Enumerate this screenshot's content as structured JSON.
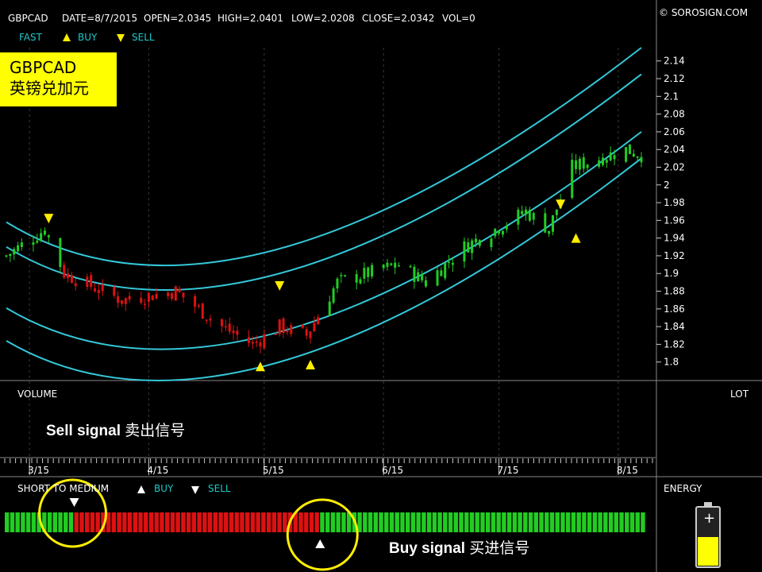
{
  "header": {
    "symbol": "GBPCAD",
    "date": "DATE=8/7/2015",
    "open": "OPEN=2.0345",
    "high": "HIGH=2.0401",
    "low": "LOW=2.0208",
    "close": "CLOSE=2.0342",
    "vol": "VOL=0",
    "copyright": "© SOROSIGN.COM"
  },
  "legend": {
    "fast": "FAST",
    "buy": "BUY",
    "sell": "SELL"
  },
  "instrument_box": {
    "line1": "GBPCAD",
    "line2": "英镑兑加元"
  },
  "volume_panel": {
    "label": "VOLUME",
    "lot": "LOT"
  },
  "annotations": {
    "sell_en": "Sell signal",
    "sell_cn": "卖出信号",
    "buy_en": "Buy signal",
    "buy_cn": "买进信号"
  },
  "short_panel": {
    "label": "SHORT TO MEDIUM",
    "buy": "BUY",
    "sell": "SELL"
  },
  "energy_panel": {
    "label": "ENERGY"
  },
  "colors": {
    "up": "#22cc22",
    "down": "#dd1111",
    "channel": "#33c8d8",
    "marker": "#ffee00",
    "highlight_circle": "#ffee00",
    "energy_fill": "#ffff00"
  },
  "chart_data": {
    "type": "candlestick",
    "title": "GBPCAD",
    "y_axis": {
      "ylim": [
        1.78,
        2.155
      ],
      "ticks": [
        "1.8",
        "1.82",
        "1.84",
        "1.86",
        "1.88",
        "1.9",
        "1.92",
        "1.94",
        "1.96",
        "1.98",
        "2",
        "2.02",
        "2.04",
        "2.06",
        "2.08",
        "2.1",
        "2.12",
        "2.14"
      ]
    },
    "x_axis": {
      "range": [
        "2015-02-23",
        "2015-08-07"
      ],
      "labels": [
        "3/15",
        "4/15",
        "5/15",
        "6/15",
        "7/15",
        "8/15"
      ]
    },
    "price_anchors": [
      {
        "date": "2015-02-23",
        "close": 1.92
      },
      {
        "date": "2015-03-05",
        "close": 1.95
      },
      {
        "date": "2015-03-10",
        "close": 1.9
      },
      {
        "date": "2015-03-25",
        "close": 1.87
      },
      {
        "date": "2015-04-08",
        "close": 1.88
      },
      {
        "date": "2015-04-20",
        "close": 1.84
      },
      {
        "date": "2015-04-28",
        "close": 1.82
      },
      {
        "date": "2015-05-05",
        "close": 1.84
      },
      {
        "date": "2015-05-12",
        "close": 1.83
      },
      {
        "date": "2015-05-20",
        "close": 1.89
      },
      {
        "date": "2015-06-05",
        "close": 1.91
      },
      {
        "date": "2015-06-12",
        "close": 1.89
      },
      {
        "date": "2015-06-22",
        "close": 1.93
      },
      {
        "date": "2015-07-08",
        "close": 1.97
      },
      {
        "date": "2015-07-14",
        "close": 1.95
      },
      {
        "date": "2015-07-20",
        "close": 2.02
      },
      {
        "date": "2015-08-03",
        "close": 2.04
      },
      {
        "date": "2015-08-07",
        "close": 2.034
      }
    ],
    "trend": "bearish from 2015-03-10 to 2015-05-15; bullish otherwise",
    "channels": [
      {
        "name": "outer-upper",
        "points": [
          [
            "2015-02-23",
            1.958
          ],
          [
            "2015-05-05",
            1.928
          ],
          [
            "2015-08-07",
            2.155
          ]
        ]
      },
      {
        "name": "inner-upper",
        "points": [
          [
            "2015-02-23",
            1.93
          ],
          [
            "2015-05-05",
            1.9
          ],
          [
            "2015-08-07",
            2.125
          ]
        ]
      },
      {
        "name": "inner-lower",
        "points": [
          [
            "2015-02-23",
            1.861
          ],
          [
            "2015-05-05",
            1.834
          ],
          [
            "2015-08-07",
            2.06
          ]
        ]
      },
      {
        "name": "outer-lower",
        "points": [
          [
            "2015-02-23",
            1.824
          ],
          [
            "2015-05-05",
            1.8
          ],
          [
            "2015-08-07",
            2.03
          ]
        ]
      }
    ],
    "signals": [
      {
        "type": "sell",
        "date": "2015-03-06",
        "price": 1.962
      },
      {
        "type": "buy",
        "date": "2015-04-30",
        "price": 1.795
      },
      {
        "type": "sell",
        "date": "2015-05-05",
        "price": 1.886
      },
      {
        "type": "buy",
        "date": "2015-05-13",
        "price": 1.797
      },
      {
        "type": "sell",
        "date": "2015-07-17",
        "price": 1.978
      },
      {
        "type": "buy",
        "date": "2015-07-21",
        "price": 1.94
      }
    ],
    "short_to_medium_bars": {
      "count": 120,
      "segments": [
        {
          "from": 0,
          "to": 13,
          "state": "bullish"
        },
        {
          "from": 13,
          "to": 59,
          "state": "bearish"
        },
        {
          "from": 59,
          "to": 120,
          "state": "bullish"
        }
      ],
      "sell_marker_bar": 13,
      "buy_marker_bar": 59
    },
    "energy_level": 0.5
  }
}
